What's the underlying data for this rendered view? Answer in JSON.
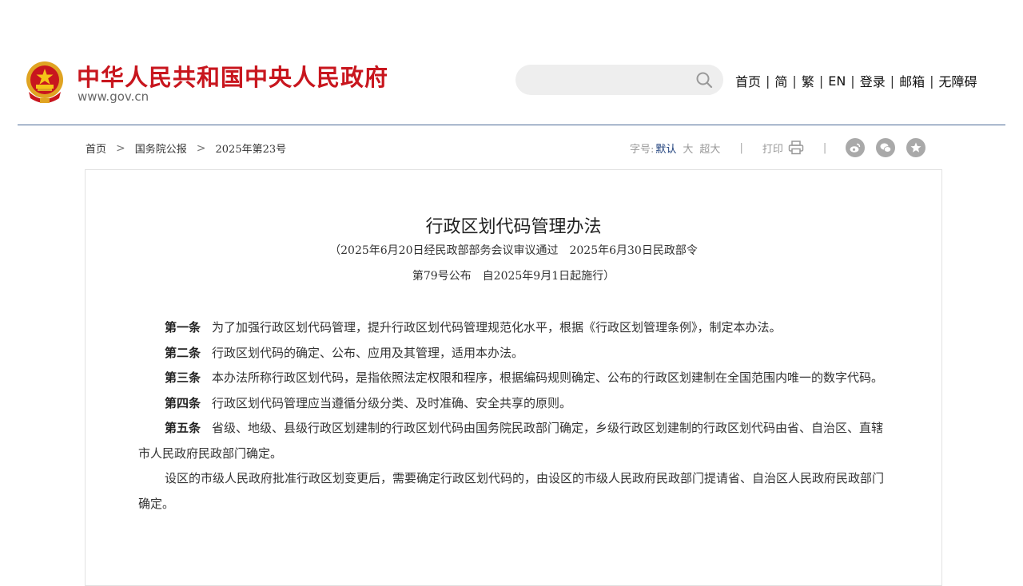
{
  "header": {
    "site_title": "中华人民共和国中央人民政府",
    "site_domain": "www.gov.cn",
    "emblem_icon": "national-emblem-icon",
    "search": {
      "placeholder": "",
      "icon": "search-icon"
    },
    "nav": [
      "首页",
      "简",
      "繁",
      "EN",
      "登录",
      "邮箱",
      "无障碍"
    ],
    "nav_separator": "|",
    "colors": {
      "title_red": "#c8161e",
      "rule_blue": "#4a6896"
    }
  },
  "breadcrumb": {
    "items": [
      "首页",
      "国务院公报",
      "2025年第23号"
    ],
    "separator": ">"
  },
  "tools": {
    "font_size_label": "字号:",
    "font_sizes": [
      "默认",
      "大",
      "超大"
    ],
    "active_font_size": "默认",
    "divider": "|",
    "print_label": "打印",
    "print_icon": "printer-icon",
    "share_icons": [
      "weibo-icon",
      "wechat-icon",
      "favorite-star-icon"
    ],
    "active_color": "#1b3d7a"
  },
  "article": {
    "title": "行政区划代码管理办法",
    "subtitle_line1": "（2025年6月20日经民政部部务会议审议通过　2025年6月30日民政部令",
    "subtitle_line2": "第79号公布　自2025年9月1日起施行）",
    "paragraphs": [
      {
        "label": "第一条",
        "text": "为了加强行政区划代码管理，提升行政区划代码管理规范化水平，根据《行政区划管理条例》，制定本办法。"
      },
      {
        "label": "第二条",
        "text": "行政区划代码的确定、公布、应用及其管理，适用本办法。"
      },
      {
        "label": "第三条",
        "text": "本办法所称行政区划代码，是指依照法定权限和程序，根据编码规则确定、公布的行政区划建制在全国范围内唯一的数字代码。"
      },
      {
        "label": "第四条",
        "text": "行政区划代码管理应当遵循分级分类、及时准确、安全共享的原则。"
      },
      {
        "label": "第五条",
        "text": "省级、地级、县级行政区划建制的行政区划代码由国务院民政部门确定，乡级行政区划建制的行政区划代码由省、自治区、直辖市人民政府民政部门确定。"
      },
      {
        "label": "",
        "text": "设区的市级人民政府批准行政区划变更后，需要确定行政区划代码的，由设区的市级人民政府民政部门提请省、自治区人民政府民政部门确定。"
      }
    ]
  }
}
